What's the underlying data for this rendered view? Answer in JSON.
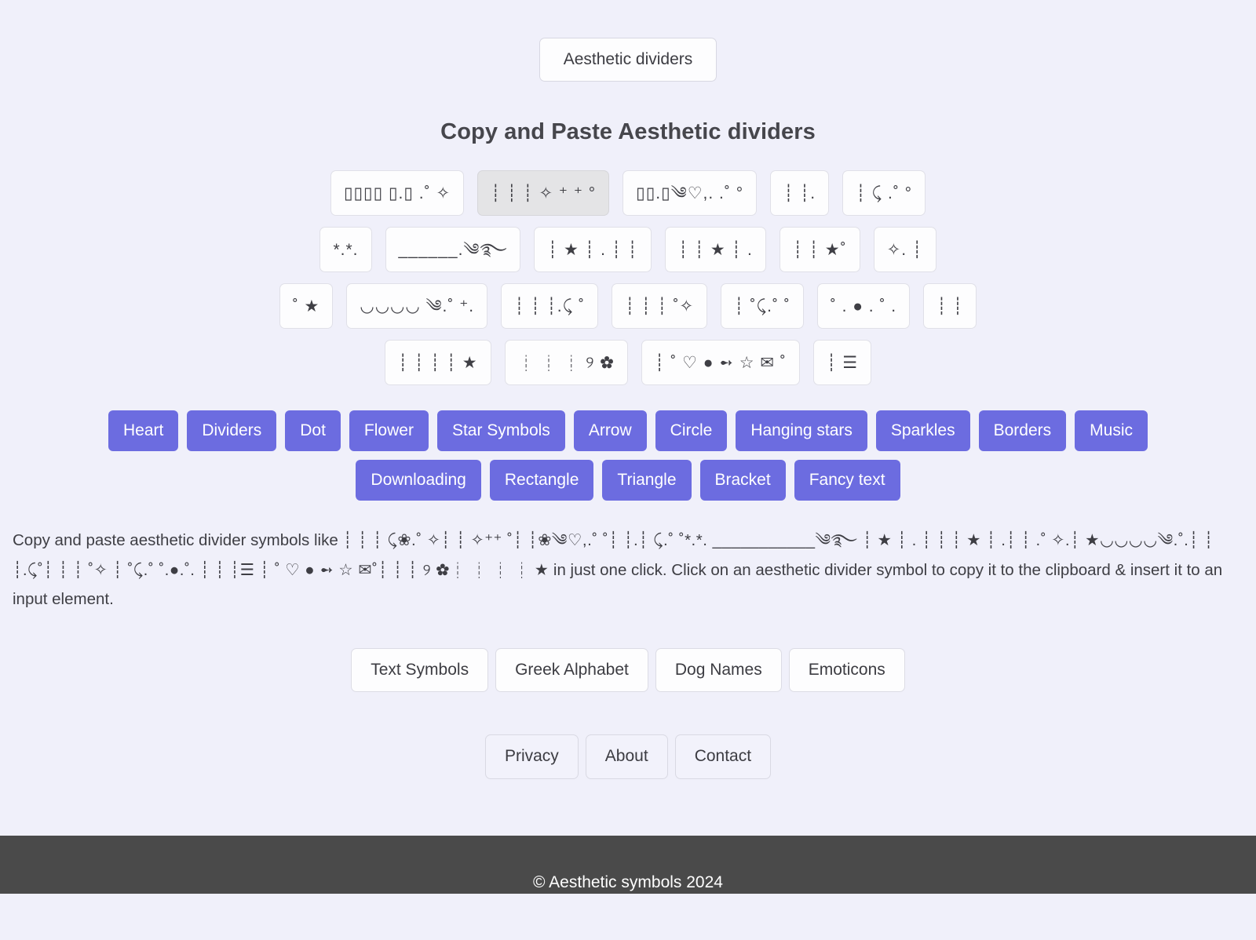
{
  "site": {
    "background_color": "#f0f0fa",
    "accent_color": "#6c6ce0",
    "footer_color": "#4a4a4a"
  },
  "top_chip": {
    "label": "Aesthetic dividers"
  },
  "heading": {
    "title": "Copy and Paste Aesthetic dividers"
  },
  "symbol_rows": [
    {
      "tiles": [
        {
          "name": "divider-tile-1",
          "text": "▯▯▯▯ ▯.▯ .˚ ✧",
          "selected": false
        },
        {
          "name": "divider-tile-2",
          "text": "┊ ┊ ┊ ✧ ⁺ ⁺    °",
          "selected": true
        },
        {
          "name": "divider-tile-3",
          "text": "▯▯.▯༄♡,. .˚      °",
          "selected": false
        },
        {
          "name": "divider-tile-4",
          "text": "┊ ┊.",
          "selected": false
        },
        {
          "name": "divider-tile-5",
          "text": "┊ ⤹ .˚      °",
          "selected": false
        }
      ]
    },
    {
      "tiles": [
        {
          "name": "divider-tile-6",
          "text": "*.*.",
          "selected": false
        },
        {
          "name": "divider-tile-7",
          "text": "______.༄࿐",
          "selected": false
        },
        {
          "name": "divider-tile-8",
          "text": "┊ ★ ┊ . ┊ ┊",
          "selected": false
        },
        {
          "name": "divider-tile-9",
          "text": "┊ ┊ ★ ┊ .",
          "selected": false
        },
        {
          "name": "divider-tile-10",
          "text": "┊ ┊ ★˚",
          "selected": false
        },
        {
          "name": "divider-tile-11",
          "text": "✧. ┊",
          "selected": false
        }
      ]
    },
    {
      "tiles": [
        {
          "name": "divider-tile-12",
          "text": "˚ ★",
          "selected": false
        },
        {
          "name": "divider-tile-13",
          "text": "◡◡◡◡ ༄.˚ ⁺.",
          "selected": false
        },
        {
          "name": "divider-tile-14",
          "text": "┊ ┊ ┊.⤹ ˚",
          "selected": false
        },
        {
          "name": "divider-tile-15",
          "text": "┊ ┊ ┊ ˚✧",
          "selected": false
        },
        {
          "name": "divider-tile-16",
          "text": "┊ ˚⤹.˚ ˚",
          "selected": false
        },
        {
          "name": "divider-tile-17",
          "text": "˚ . ● . ˚ .",
          "selected": false
        },
        {
          "name": "divider-tile-18",
          "text": "┊ ┊",
          "selected": false
        }
      ]
    },
    {
      "tiles": [
        {
          "name": "divider-tile-19",
          "text": "┊ ┊ ┊ ┊ ★",
          "selected": false
        },
        {
          "name": "divider-tile-20",
          "text": "┊ ┊ ┊ ୨ ✿",
          "selected": false
        },
        {
          "name": "divider-tile-21",
          "text": "┊ ˚ ♡ ● ➻ ☆ ✉ ˚",
          "selected": false
        },
        {
          "name": "divider-tile-22",
          "text": "┊ ☰",
          "selected": false
        }
      ]
    }
  ],
  "categories": [
    {
      "name": "category-heart",
      "label": "Heart"
    },
    {
      "name": "category-dividers",
      "label": "Dividers"
    },
    {
      "name": "category-dot",
      "label": "Dot"
    },
    {
      "name": "category-flower",
      "label": "Flower"
    },
    {
      "name": "category-star-symbols",
      "label": "Star Symbols"
    },
    {
      "name": "category-arrow",
      "label": "Arrow"
    },
    {
      "name": "category-circle",
      "label": "Circle"
    },
    {
      "name": "category-hanging-stars",
      "label": "Hanging stars"
    },
    {
      "name": "category-sparkles",
      "label": "Sparkles"
    },
    {
      "name": "category-borders",
      "label": "Borders"
    },
    {
      "name": "category-music",
      "label": "Music"
    },
    {
      "name": "category-downloading",
      "label": "Downloading"
    },
    {
      "name": "category-rectangle",
      "label": "Rectangle"
    },
    {
      "name": "category-triangle",
      "label": "Triangle"
    },
    {
      "name": "category-bracket",
      "label": "Bracket"
    },
    {
      "name": "category-fancy-text",
      "label": "Fancy text"
    }
  ],
  "description": {
    "lead": "Copy and paste aesthetic divider symbols like ",
    "symbols": "┊ ┊ ┊ ⤹❀.˚ ✧┊ ┊ ✧⁺⁺   ˚┊ ┊❀༄♡,.˚    ˚┊ ┊.┊ ⤹.˚     ˚*.*.  ___________༄࿐  ┊ ★ ┊ . ┊ ┊ ┊ ★ ┊ .┊ ┊ .˚ ✧.┊   ★◡◡◡◡༄.˚.┊ ┊ ┊.⤹˚┊ ┊ ┊ ˚✧ ┊ ˚⤹.˚ ˚.●.˚. ┊ ┊ ┊☰ ┊ ˚ ♡ ● ➻ ☆ ✉˚┊ ┊ ┊ ୨ ✿┊ ┊ ┊ ┊ ★ ",
    "tail": "in just one click. Click on an aesthetic divider symbol to copy it to the clipboard & insert it to an input element."
  },
  "link_buttons": [
    {
      "name": "link-text-symbols",
      "label": "Text Symbols"
    },
    {
      "name": "link-greek-alphabet",
      "label": "Greek Alphabet"
    },
    {
      "name": "link-dog-names",
      "label": "Dog Names"
    },
    {
      "name": "link-emoticons",
      "label": "Emoticons"
    }
  ],
  "footer_nav": [
    {
      "name": "footer-privacy",
      "label": "Privacy"
    },
    {
      "name": "footer-about",
      "label": "About"
    },
    {
      "name": "footer-contact",
      "label": "Contact"
    }
  ],
  "footer_bar": {
    "copyright": "© Aesthetic symbols 2024"
  }
}
